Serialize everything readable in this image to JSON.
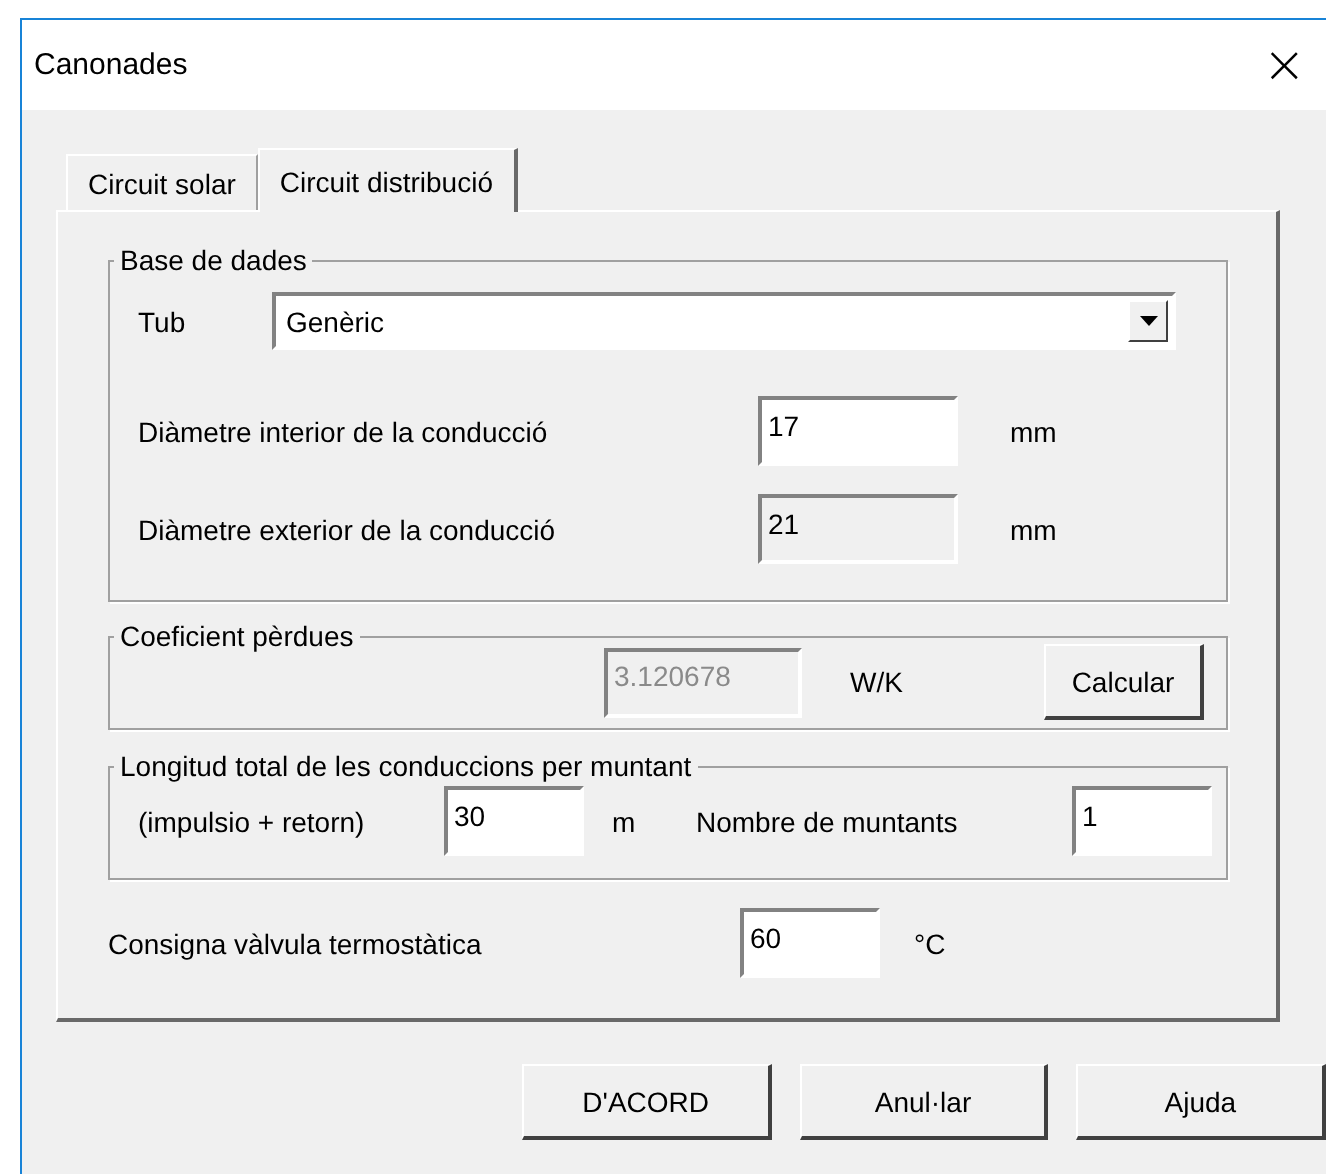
{
  "window": {
    "title": "Canonades",
    "close": "×"
  },
  "tabs": [
    {
      "label": "Circuit solar",
      "selected": false
    },
    {
      "label": "Circuit distribució",
      "selected": true
    }
  ],
  "database": {
    "title": "Base de dades",
    "tube_label": "Tub",
    "tube_value": "Genèric",
    "rows": [
      {
        "label": "Diàmetre interior de la conducció",
        "value": "17",
        "kind": "editable",
        "unit": "mm"
      },
      {
        "label": "Diàmetre exterior de la conducció",
        "value": "21",
        "kind": "readonly",
        "unit": "mm"
      }
    ]
  },
  "losses": {
    "title": "Coeficient pèrdues",
    "value": "3.120678",
    "kind": "disabled",
    "unit": "W/K",
    "button": "Calcular"
  },
  "length": {
    "title": "Longitud total de les conduccions per muntant",
    "label": "(impulsio + retorn)",
    "value": "30",
    "unit": "m",
    "count_label": "Nombre de muntants",
    "count_value": "1"
  },
  "setpoint": {
    "label": "Consigna vàlvula termostàtica",
    "value": "60",
    "unit": "°C"
  },
  "buttons": [
    "D'ACORD",
    "Anul·lar",
    "Ajuda"
  ]
}
